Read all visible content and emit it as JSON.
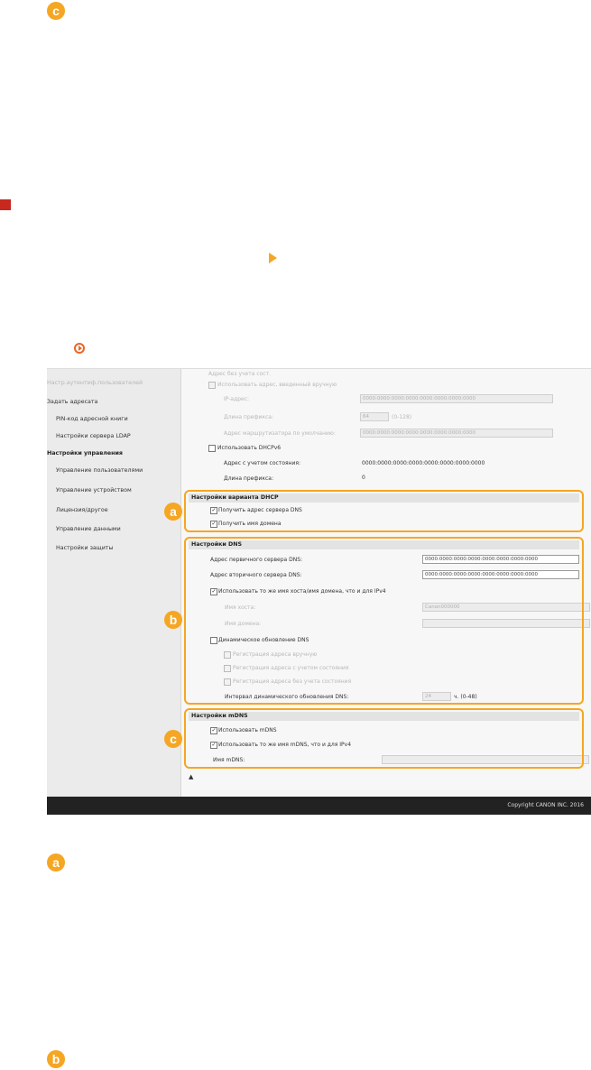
{
  "markers": {
    "c": "c",
    "a": "a",
    "b": "b"
  },
  "left_nav": {
    "items": [
      {
        "label": "Настр.аутентиф.пользователей",
        "type": "faded"
      },
      {
        "label": "Задать адресата",
        "type": "plain"
      },
      {
        "label": "PIN-код адресной книги",
        "type": "ind"
      },
      {
        "label": "Настройки сервера LDAP",
        "type": "ind"
      },
      {
        "label": "Настройки управления",
        "type": "hdr"
      },
      {
        "label": "Управление пользователями",
        "type": "ind"
      },
      {
        "label": "Управление устройством",
        "type": "ind"
      },
      {
        "label": "Лицензия/другое",
        "type": "ind"
      },
      {
        "label": "Управление данными",
        "type": "ind"
      },
      {
        "label": "Настройки защиты",
        "type": "ind"
      }
    ]
  },
  "ipv6": {
    "faded_top": "Адрес без учета сост.",
    "manual_label": "Использовать адрес, введенный вручную",
    "ip_label": "IP-адрес:",
    "ip_value": "0000:0000:0000:0000:0000:0000:0000:0000",
    "prefix_label": "Длина префикса:",
    "prefix_value": "64",
    "prefix_range": "(0-128)",
    "gateway_label": "Адрес маршрутизатора по умолчанию:",
    "gateway_value": "0000:0000:0000:0000:0000:0000:0000:0000",
    "dhcpv6_label": "Использовать DHCPv6",
    "stateful_label": "Адрес с учетом состояния:",
    "stateful_value": "0000:0000:0000:0000:0000:0000:0000:0000",
    "prefix2_label": "Длина префикса:",
    "prefix2_value": "0"
  },
  "dhcp_section": {
    "title": "Настройки варианта DHCP",
    "dns_label": "Получить адрес сервера DNS",
    "domain_label": "Получить имя домена"
  },
  "dns_section": {
    "title": "Настройки DNS",
    "primary_label": "Адрес первичного сервера DNS:",
    "primary_value": "0000:0000:0000:0000:0000:0000:0000:0000",
    "secondary_label": "Адрес вторичного сервера DNS:",
    "secondary_value": "0000:0000:0000:0000:0000:0000:0000:0000",
    "same_host_label": "Использовать то же имя хоста/имя домена, что и для IPv4",
    "host_label": "Имя хоста:",
    "host_value": "Canon000000",
    "domain_label": "Имя домена:",
    "domain_value": "",
    "dyn_update_label": "Динамическое обновление DNS",
    "reg_manual_label": "Регистрация адреса вручную",
    "reg_stateful_label": "Регистрация адреса с учетом состояния",
    "reg_stateless_label": "Регистрация адреса без учета состояния",
    "interval_label": "Интервал динамического обновления DNS:",
    "interval_value": "24",
    "interval_unit": "ч. (0-48)"
  },
  "mdns_section": {
    "title": "Настройки mDNS",
    "use_label": "Использовать mDNS",
    "same_label": "Использовать то же имя mDNS, что и для IPv4",
    "name_label": "Имя mDNS:",
    "name_value": ""
  },
  "footer": {
    "copyright": "Copyright CANON INC. 2016"
  },
  "top_link_icon": "▲",
  "check": "✓"
}
